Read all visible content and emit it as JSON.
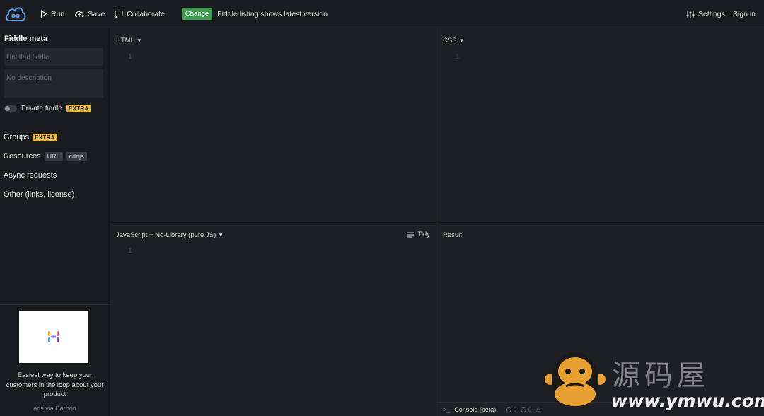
{
  "topbar": {
    "run": "Run",
    "save": "Save",
    "collaborate": "Collaborate",
    "change_badge": "Change",
    "listing_text": "Fiddle listing shows latest version",
    "settings": "Settings",
    "sign_in": "Sign in"
  },
  "sidebar": {
    "title": "Fiddle meta",
    "title_placeholder": "Untitled fiddle",
    "description_placeholder": "No description",
    "private_label": "Private fiddle",
    "extra_badge": "EXTRA",
    "groups": "Groups",
    "resources": "Resources",
    "resources_url": "URL",
    "resources_cdnjs": "cdnjs",
    "async": "Async requests",
    "other": "Other (links, license)"
  },
  "ad": {
    "text": "Easiest way to keep your customers in the loop about your product",
    "via": "ads via Carbon"
  },
  "panels": {
    "html_label": "HTML",
    "css_label": "CSS",
    "js_label": "JavaScript + No-Library (pure JS)",
    "result_label": "Result",
    "tidy": "Tidy",
    "line_one": "1",
    "console": "Console (beta)",
    "console_errors": "0",
    "console_info": "0"
  },
  "watermark": {
    "cn": "源码屋",
    "url": "www.ymwu.com"
  },
  "colors": {
    "accent_green": "#3f9b4f",
    "extra_yellow": "#e7b83a",
    "bg": "#1e1f22"
  }
}
